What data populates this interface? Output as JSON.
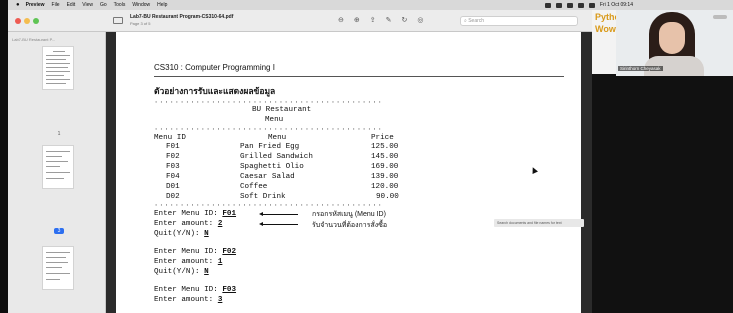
{
  "menubar": {
    "apple": "",
    "items": [
      "Preview",
      "File",
      "Edit",
      "View",
      "Go",
      "Tools",
      "Window",
      "Help"
    ],
    "clock": "Fri 1 Oct 09:14"
  },
  "window": {
    "doc_title": "Lab7-BU Restaurant Program-CS310-64.pdf",
    "doc_subtitle": "Page 3 of 5",
    "search_placeholder": "Search"
  },
  "sidebar": {
    "label": "Lab7-BU Restaurant P...",
    "pages": [
      "1",
      "2",
      "3"
    ],
    "selected_page": "3"
  },
  "page": {
    "course": "CS310 : Computer Programming I",
    "heading": "ตัวอย่างการรับและแสดงผลข้อมูล",
    "restaurant": "BU Restaurant",
    "menu_word": "Menu",
    "col_id": "Menu ID",
    "col_menu": "Menu",
    "col_price": "Price",
    "items": [
      {
        "id": "F01",
        "name": "Pan Fried Egg",
        "price": "125.00"
      },
      {
        "id": "F02",
        "name": "Grilled Sandwich",
        "price": "145.00"
      },
      {
        "id": "F03",
        "name": "Spaghetti Olio",
        "price": "169.00"
      },
      {
        "id": "F04",
        "name": "Caesar Salad",
        "price": "139.00"
      },
      {
        "id": "D01",
        "name": "Coffee",
        "price": "120.00"
      },
      {
        "id": "D02",
        "name": "Soft Drink",
        "price": "90.00"
      }
    ],
    "prompt_id": "Enter Menu ID: ",
    "prompt_amount": "Enter amount: ",
    "prompt_quit": "Quit(Y/N): ",
    "entries": [
      {
        "id": "F01",
        "amount": "2",
        "quit": "N"
      },
      {
        "id": "F02",
        "amount": "1",
        "quit": "N"
      },
      {
        "id": "F03",
        "amount": "3"
      }
    ],
    "note_id": "กรอกรหัสเมนู (Menu ID)",
    "note_amount": "รับจำนวนที่ต้องการสั่งซื้อ"
  },
  "tooltip": "Search documents and file names for text",
  "webcam": {
    "slide_text_1": "Pytho",
    "slide_text_2": "Woww",
    "name": "Sirinthorn Cheyasak"
  }
}
